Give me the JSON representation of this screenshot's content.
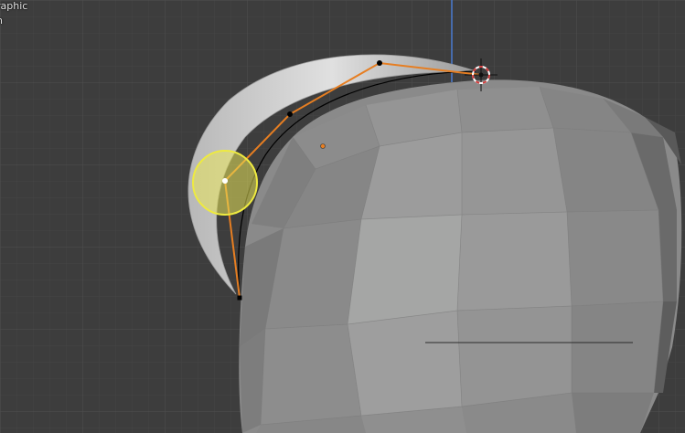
{
  "viewport": {
    "overlay": {
      "view_mode_text": "raphic",
      "collection_text": "h"
    }
  },
  "colors": {
    "background": "#3d3d3d",
    "grid_minor": "#474747",
    "grid_major": "#4f4f4f",
    "axis_z": "#4a7bd0",
    "curve_handle": "#e67e22",
    "brush_circle": "#e8e35a",
    "mesh_base": "#8a8a8a",
    "cursor_red": "#d23b3b"
  },
  "icons": {
    "cursor": "3d-cursor-icon"
  }
}
